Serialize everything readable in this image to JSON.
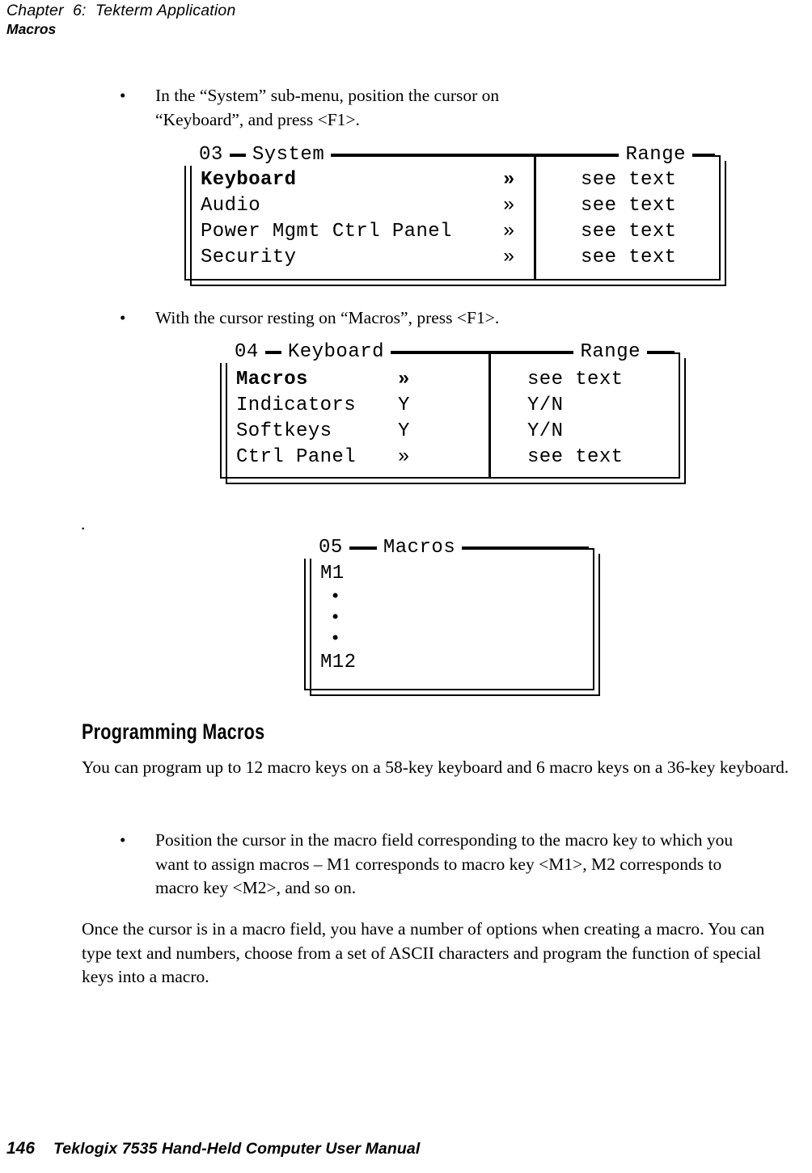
{
  "header": {
    "chapter": "Chapter  6:  Tekterm Application",
    "section": "Macros"
  },
  "content": {
    "bullet_1": {
      "marker": "•",
      "text": "In the “System” sub-menu, position the cursor on “Keyboard”, and press <F1>."
    },
    "bullet_2": {
      "marker": "•",
      "text": "With the cursor resting on “Macros”, press <F1>."
    },
    "stray_period": ".",
    "heading_programming_macros": "Programming Macros",
    "para_1": "You can program up to 12 macro keys on a 58-key keyboard and 6 macro keys on a 36-key keyboard.",
    "bullet_3": {
      "marker": "•",
      "text": "Position the cursor in the macro field corresponding to the macro key to which you want to assign macros – M1 corresponds to macro key <M1>, M2 corresponds to macro key <M2>, and so on."
    },
    "para_2": "Once the cursor is in a macro field, you have a number of options when creating a macro. You can type text and numbers, choose from a set of ASCII characters and program the function of special keys into a macro."
  },
  "menus": [
    {
      "id": "03",
      "title": "System",
      "range_title": "Range",
      "rows": [
        {
          "label": "Keyboard",
          "value": "»",
          "range": "see text",
          "selected": true
        },
        {
          "label": "Audio",
          "value": "»",
          "range": "see text",
          "selected": false
        },
        {
          "label": "Power Mgmt Ctrl Panel",
          "value": "»",
          "range": "see text",
          "selected": false
        },
        {
          "label": "Security",
          "value": "»",
          "range": "see text",
          "selected": false
        }
      ]
    },
    {
      "id": "04",
      "title": "Keyboard",
      "range_title": "Range",
      "rows": [
        {
          "label": "Macros",
          "value": "»",
          "range": "see text",
          "selected": true
        },
        {
          "label": "Indicators",
          "value": "Y",
          "range": "Y/N",
          "selected": false
        },
        {
          "label": "Softkeys",
          "value": "Y",
          "range": "Y/N",
          "selected": false
        },
        {
          "label": "Ctrl Panel",
          "value": "»",
          "range": "see text",
          "selected": false
        }
      ]
    },
    {
      "id": "05",
      "title": "Macros",
      "first_item": "M1",
      "ellipsis_dot": "•",
      "last_item": "M12"
    }
  ],
  "footer": {
    "page_number": "146",
    "manual_title": "Teklogix 7535 Hand-Held Computer User Manual"
  }
}
